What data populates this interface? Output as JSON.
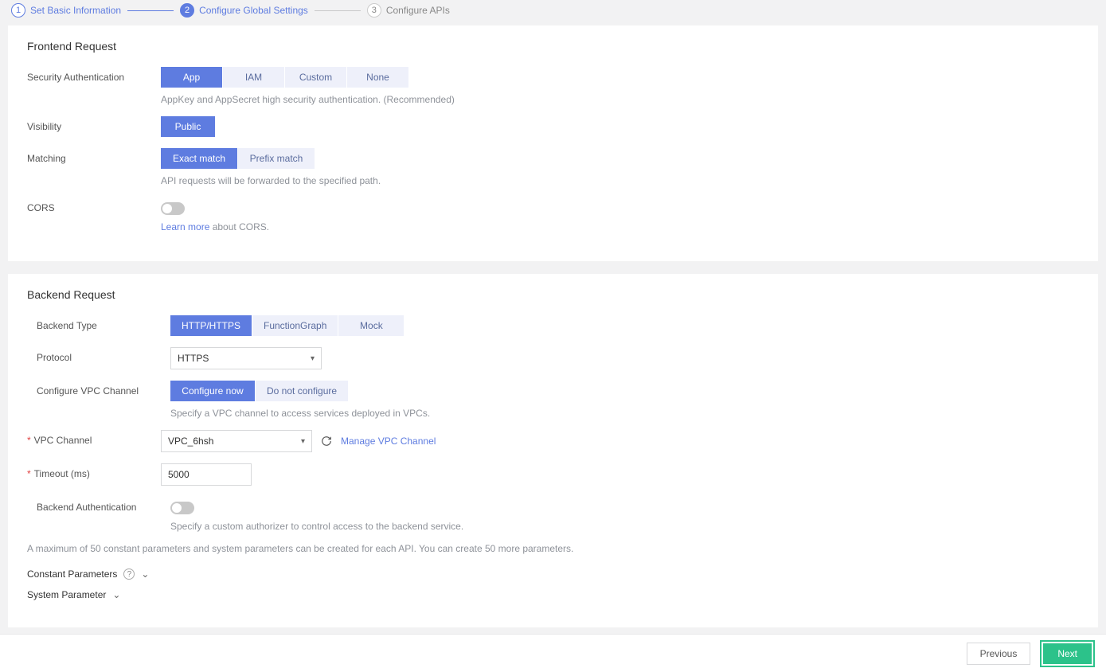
{
  "stepper": {
    "steps": [
      {
        "num": "1",
        "label": "Set Basic Information"
      },
      {
        "num": "2",
        "label": "Configure Global Settings"
      },
      {
        "num": "3",
        "label": "Configure APIs"
      }
    ]
  },
  "frontend": {
    "title": "Frontend Request",
    "security_label": "Security Authentication",
    "security_options": {
      "app": "App",
      "iam": "IAM",
      "custom": "Custom",
      "none": "None"
    },
    "security_help": "AppKey and AppSecret high security authentication. (Recommended)",
    "visibility_label": "Visibility",
    "visibility_option": "Public",
    "matching_label": "Matching",
    "matching_options": {
      "exact": "Exact match",
      "prefix": "Prefix match"
    },
    "matching_help": "API requests will be forwarded to the specified path.",
    "cors_label": "CORS",
    "cors_learn_more": "Learn more",
    "cors_about": " about CORS."
  },
  "backend": {
    "title": "Backend Request",
    "type_label": "Backend Type",
    "type_options": {
      "http": "HTTP/HTTPS",
      "fg": "FunctionGraph",
      "mock": "Mock"
    },
    "protocol_label": "Protocol",
    "protocol_value": "HTTPS",
    "vpc_cfg_label": "Configure VPC Channel",
    "vpc_cfg_options": {
      "now": "Configure now",
      "not": "Do not configure"
    },
    "vpc_cfg_help": "Specify a VPC channel to access services deployed in VPCs.",
    "vpc_channel_label": "VPC Channel",
    "vpc_channel_value": "VPC_6hsh",
    "manage_vpc_link": "Manage VPC Channel",
    "timeout_label": "Timeout (ms)",
    "timeout_value": "5000",
    "backend_auth_label": "Backend Authentication",
    "backend_auth_help": "Specify a custom authorizer to control access to the backend service.",
    "params_note": "A maximum of 50 constant parameters and system parameters can be created for each API. You can create 50 more parameters.",
    "constant_params_label": "Constant Parameters",
    "system_param_label": "System Parameter"
  },
  "footer": {
    "previous": "Previous",
    "next": "Next"
  }
}
